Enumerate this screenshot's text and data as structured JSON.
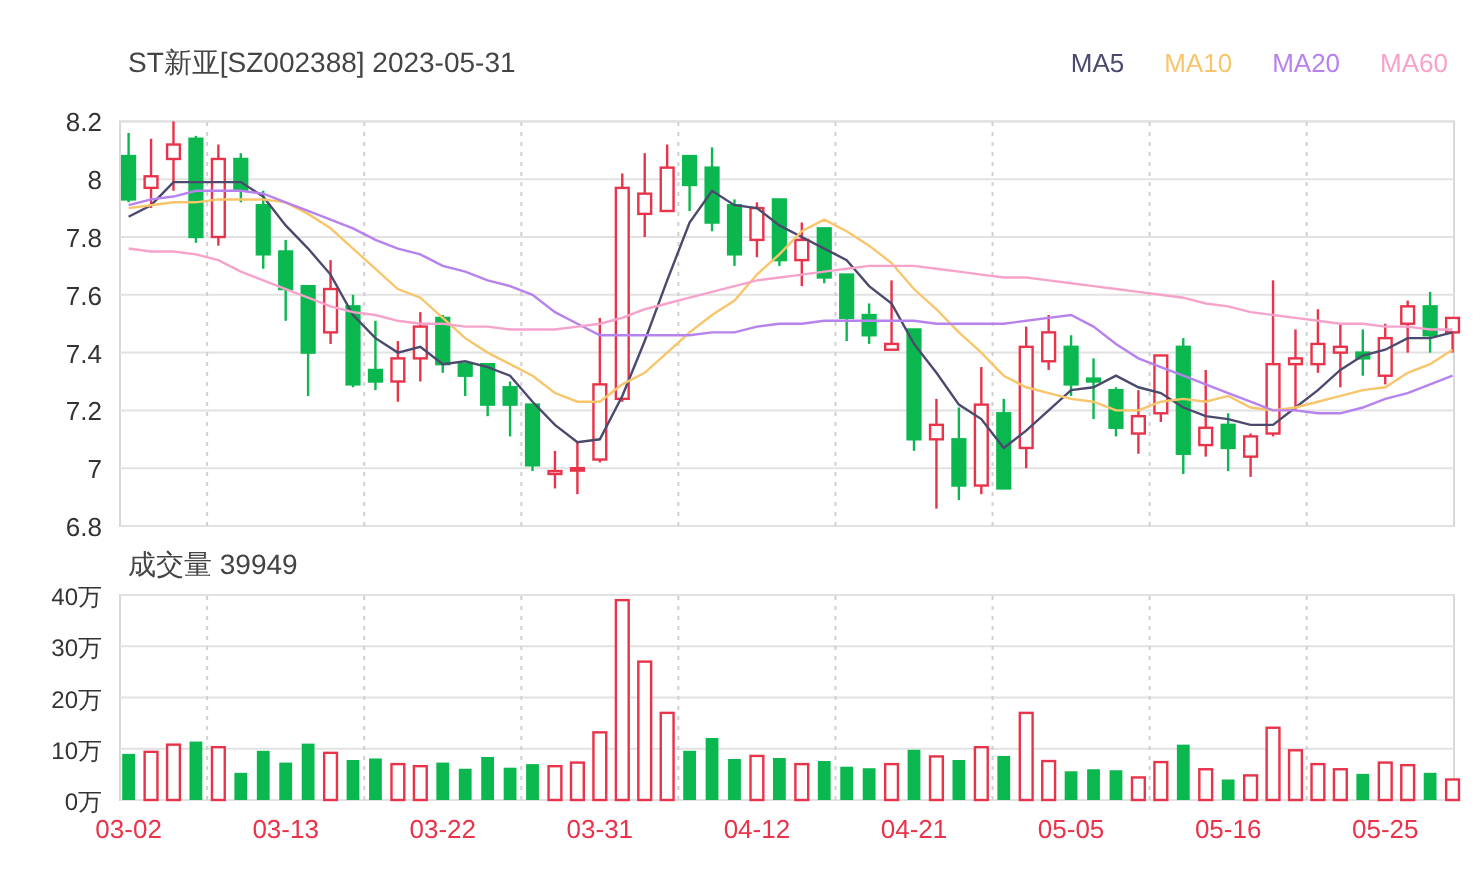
{
  "title": "ST新亚[SZ002388] 2023-05-31",
  "price_chart": {
    "chart_data": {
      "type": "candlestick",
      "grid": true,
      "ylim": [
        6.8,
        8.2
      ],
      "yticks": [
        6.8,
        7,
        7.2,
        7.4,
        7.6,
        7.8,
        8,
        8.2
      ],
      "categories": [
        null,
        null,
        null,
        null,
        null,
        null,
        null,
        null,
        null,
        null,
        null,
        null,
        null,
        null,
        null,
        null,
        null,
        null,
        null,
        null,
        null,
        null,
        null,
        null,
        null,
        null,
        null,
        null,
        null,
        null,
        null,
        null,
        null,
        null,
        null,
        null,
        null,
        null,
        null,
        null,
        null,
        null,
        null,
        null,
        null,
        null,
        null,
        null,
        null,
        null,
        null,
        null,
        null,
        null,
        null,
        null,
        null,
        null,
        null,
        null
      ],
      "ohlc": [
        [
          8.08,
          8.16,
          7.92,
          7.93
        ],
        [
          7.97,
          8.14,
          7.9,
          8.01
        ],
        [
          8.07,
          8.2,
          7.96,
          8.12
        ],
        [
          8.14,
          8.15,
          7.78,
          7.8
        ],
        [
          7.8,
          8.12,
          7.77,
          8.07
        ],
        [
          8.07,
          8.09,
          7.92,
          7.96
        ],
        [
          7.91,
          7.96,
          7.69,
          7.74
        ],
        [
          7.75,
          7.79,
          7.51,
          7.62
        ],
        [
          7.63,
          7.63,
          7.25,
          7.4
        ],
        [
          7.47,
          7.72,
          7.43,
          7.62
        ],
        [
          7.56,
          7.6,
          7.28,
          7.29
        ],
        [
          7.34,
          7.51,
          7.27,
          7.3
        ],
        [
          7.3,
          7.44,
          7.23,
          7.38
        ],
        [
          7.38,
          7.54,
          7.3,
          7.49
        ],
        [
          7.52,
          7.53,
          7.33,
          7.36
        ],
        [
          7.36,
          7.36,
          7.25,
          7.32
        ],
        [
          7.36,
          7.36,
          7.18,
          7.22
        ],
        [
          7.28,
          7.3,
          7.11,
          7.22
        ],
        [
          7.22,
          7.22,
          6.99,
          7.01
        ],
        [
          6.98,
          7.06,
          6.93,
          6.99
        ],
        [
          7.0,
          7.09,
          6.91,
          7.0
        ],
        [
          7.03,
          7.52,
          7.02,
          7.29
        ],
        [
          7.24,
          8.02,
          7.23,
          7.97
        ],
        [
          7.88,
          8.09,
          7.8,
          7.95
        ],
        [
          7.89,
          8.12,
          7.89,
          8.04
        ],
        [
          8.08,
          8.08,
          7.89,
          7.98
        ],
        [
          8.04,
          8.11,
          7.82,
          7.85
        ],
        [
          7.91,
          7.93,
          7.7,
          7.74
        ],
        [
          7.79,
          7.92,
          7.73,
          7.9
        ],
        [
          7.93,
          7.93,
          7.7,
          7.72
        ],
        [
          7.72,
          7.85,
          7.63,
          7.79
        ],
        [
          7.83,
          7.83,
          7.64,
          7.66
        ],
        [
          7.67,
          7.67,
          7.44,
          7.52
        ],
        [
          7.53,
          7.57,
          7.43,
          7.46
        ],
        [
          7.41,
          7.65,
          7.41,
          7.43
        ],
        [
          7.48,
          7.48,
          7.06,
          7.1
        ],
        [
          7.1,
          7.24,
          6.86,
          7.15
        ],
        [
          7.1,
          7.21,
          6.89,
          6.94
        ],
        [
          6.94,
          7.35,
          6.91,
          7.22
        ],
        [
          7.19,
          7.24,
          6.93,
          6.93
        ],
        [
          7.07,
          7.49,
          7.0,
          7.42
        ],
        [
          7.37,
          7.53,
          7.34,
          7.47
        ],
        [
          7.42,
          7.46,
          7.25,
          7.29
        ],
        [
          7.31,
          7.38,
          7.17,
          7.3
        ],
        [
          7.27,
          7.28,
          7.11,
          7.14
        ],
        [
          7.12,
          7.27,
          7.05,
          7.18
        ],
        [
          7.19,
          7.39,
          7.16,
          7.39
        ],
        [
          7.42,
          7.45,
          6.98,
          7.05
        ],
        [
          7.08,
          7.34,
          7.04,
          7.14
        ],
        [
          7.15,
          7.19,
          6.99,
          7.07
        ],
        [
          7.04,
          7.12,
          6.97,
          7.11
        ],
        [
          7.12,
          7.65,
          7.11,
          7.36
        ],
        [
          7.36,
          7.48,
          7.2,
          7.38
        ],
        [
          7.36,
          7.55,
          7.33,
          7.43
        ],
        [
          7.4,
          7.5,
          7.28,
          7.42
        ],
        [
          7.4,
          7.48,
          7.32,
          7.38
        ],
        [
          7.32,
          7.5,
          7.29,
          7.45
        ],
        [
          7.5,
          7.58,
          7.4,
          7.56
        ],
        [
          7.56,
          7.61,
          7.4,
          7.46
        ],
        [
          7.47,
          7.52,
          7.4,
          7.52
        ]
      ],
      "series": [
        {
          "name": "MA5",
          "type": "line",
          "color": "#4b4a6e",
          "values": [
            7.87,
            7.91,
            7.99,
            7.99,
            7.99,
            7.99,
            7.94,
            7.84,
            7.76,
            7.67,
            7.53,
            7.45,
            7.4,
            7.42,
            7.36,
            7.37,
            7.35,
            7.32,
            7.23,
            7.15,
            7.09,
            7.1,
            7.25,
            7.44,
            7.65,
            7.85,
            7.96,
            7.91,
            7.9,
            7.84,
            7.8,
            7.76,
            7.72,
            7.63,
            7.57,
            7.43,
            7.33,
            7.22,
            7.17,
            7.07,
            7.13,
            7.2,
            7.27,
            7.28,
            7.32,
            7.28,
            7.26,
            7.21,
            7.18,
            7.17,
            7.15,
            7.15,
            7.21,
            7.27,
            7.34,
            7.39,
            7.41,
            7.45,
            7.45,
            7.47
          ]
        },
        {
          "name": "MA10",
          "type": "line",
          "color": "#f8c56a",
          "values": [
            7.9,
            7.91,
            7.92,
            7.92,
            7.93,
            7.93,
            7.93,
            7.92,
            7.88,
            7.83,
            7.76,
            7.69,
            7.62,
            7.59,
            7.52,
            7.45,
            7.4,
            7.36,
            7.32,
            7.26,
            7.23,
            7.23,
            7.29,
            7.33,
            7.4,
            7.47,
            7.53,
            7.58,
            7.67,
            7.74,
            7.82,
            7.86,
            7.82,
            7.77,
            7.71,
            7.62,
            7.55,
            7.47,
            7.4,
            7.32,
            7.28,
            7.26,
            7.24,
            7.23,
            7.2,
            7.2,
            7.23,
            7.24,
            7.23,
            7.25,
            7.21,
            7.2,
            7.21,
            7.23,
            7.25,
            7.27,
            7.28,
            7.33,
            7.36,
            7.41
          ]
        },
        {
          "name": "MA20",
          "type": "line",
          "color": "#b781ee",
          "values": [
            7.91,
            7.93,
            7.94,
            7.96,
            7.96,
            7.96,
            7.95,
            7.92,
            7.89,
            7.86,
            7.83,
            7.79,
            7.76,
            7.74,
            7.7,
            7.68,
            7.65,
            7.63,
            7.6,
            7.54,
            7.5,
            7.46,
            7.46,
            7.46,
            7.46,
            7.46,
            7.47,
            7.47,
            7.49,
            7.5,
            7.5,
            7.51,
            7.51,
            7.51,
            7.51,
            7.51,
            7.5,
            7.5,
            7.5,
            7.5,
            7.51,
            7.52,
            7.53,
            7.49,
            7.43,
            7.38,
            7.35,
            7.32,
            7.29,
            7.26,
            7.23,
            7.2,
            7.2,
            7.19,
            7.19,
            7.21,
            7.24,
            7.26,
            7.29,
            7.32
          ]
        },
        {
          "name": "MA60",
          "type": "line",
          "color": "#f7a2cb",
          "values": [
            7.76,
            7.75,
            7.75,
            7.74,
            7.72,
            7.68,
            7.65,
            7.62,
            7.59,
            7.56,
            7.54,
            7.53,
            7.51,
            7.5,
            7.5,
            7.49,
            7.49,
            7.48,
            7.48,
            7.48,
            7.49,
            7.5,
            7.52,
            7.55,
            7.57,
            7.59,
            7.61,
            7.63,
            7.65,
            7.66,
            7.67,
            7.68,
            7.69,
            7.7,
            7.7,
            7.7,
            7.69,
            7.68,
            7.67,
            7.66,
            7.66,
            7.65,
            7.64,
            7.63,
            7.62,
            7.61,
            7.6,
            7.59,
            7.57,
            7.56,
            7.54,
            7.53,
            7.52,
            7.51,
            7.5,
            7.5,
            7.49,
            7.49,
            7.48,
            7.48
          ]
        }
      ]
    }
  },
  "volume": {
    "label": "成交量 39949",
    "chart_data": {
      "type": "bar",
      "stacked": true,
      "grid": true,
      "ylim": [
        0,
        40
      ],
      "categories": [
        "03-02",
        null,
        null,
        null,
        null,
        null,
        null,
        "03-13",
        null,
        null,
        null,
        null,
        null,
        null,
        "03-22",
        null,
        null,
        null,
        null,
        null,
        null,
        "03-31",
        null,
        null,
        null,
        null,
        null,
        null,
        "04-12",
        null,
        null,
        null,
        null,
        null,
        null,
        "04-21",
        null,
        null,
        null,
        null,
        null,
        null,
        "05-05",
        null,
        null,
        null,
        null,
        null,
        null,
        "05-16",
        null,
        null,
        null,
        null,
        null,
        null,
        "05-25",
        null,
        null,
        null
      ],
      "yticks": [
        {
          "value": 0,
          "label": "0万"
        },
        {
          "value": 10,
          "label": "10万"
        },
        {
          "value": 20,
          "label": "20万"
        },
        {
          "value": 30,
          "label": "30万"
        },
        {
          "value": 40,
          "label": "40万"
        }
      ],
      "series": [
        {
          "color": "#e8334a",
          "values": [
            null,
            9.4,
            10.8,
            null,
            10.3,
            null,
            null,
            null,
            null,
            9.2,
            null,
            null,
            7.0,
            6.6,
            null,
            null,
            null,
            null,
            null,
            6.6,
            7.3,
            13.2,
            39.0,
            27.0,
            17.0,
            null,
            null,
            null,
            8.6,
            null,
            7.0,
            null,
            null,
            null,
            7.0,
            null,
            8.5,
            null,
            10.3,
            null,
            17.0,
            7.6,
            null,
            null,
            null,
            4.4,
            7.4,
            null,
            6.0,
            null,
            4.8,
            14.1,
            9.7,
            7.0,
            6.0,
            null,
            7.3,
            6.8,
            null,
            4.0
          ]
        },
        {
          "color": "#0ab84f",
          "values": [
            9.0,
            null,
            null,
            11.4,
            null,
            5.3,
            9.6,
            7.3,
            11.0,
            null,
            7.8,
            8.1,
            null,
            null,
            7.3,
            6.1,
            8.4,
            6.3,
            7.0,
            null,
            null,
            null,
            null,
            null,
            null,
            9.6,
            12.1,
            8.0,
            null,
            8.2,
            null,
            7.6,
            6.5,
            6.2,
            null,
            9.8,
            null,
            7.8,
            null,
            8.6,
            null,
            null,
            5.6,
            6.0,
            5.8,
            null,
            null,
            10.8,
            null,
            4.0,
            null,
            null,
            null,
            null,
            null,
            5.1,
            null,
            null,
            5.3,
            null
          ]
        }
      ]
    }
  }
}
